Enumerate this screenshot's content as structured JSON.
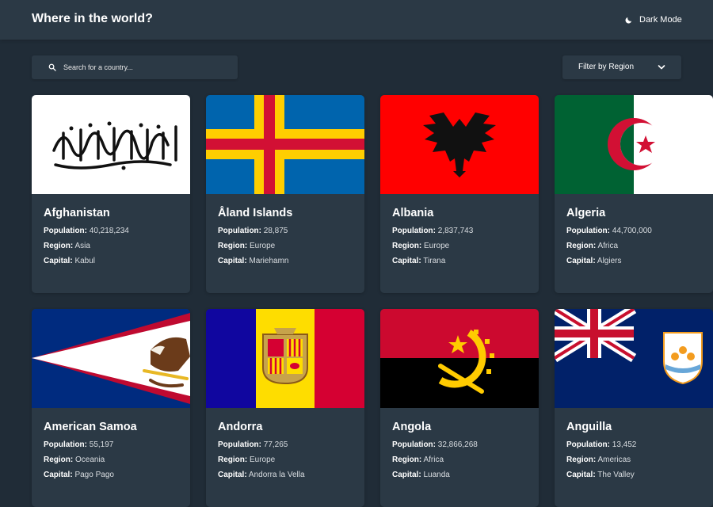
{
  "header": {
    "title": "Where in the world?",
    "dark_mode_label": "Dark Mode",
    "dark_mode_icon": "moon-icon"
  },
  "search": {
    "placeholder": "Search for a country...",
    "value": "",
    "icon": "search-icon"
  },
  "filter": {
    "label": "Filter by Region",
    "icon": "chevron-down-icon"
  },
  "labels": {
    "population": "Population:",
    "region": "Region:",
    "capital": "Capital:"
  },
  "colors": {
    "background": "#202c37",
    "elements": "#2b3945",
    "text": "#ffffff"
  },
  "countries": [
    {
      "name": "Afghanistan",
      "population": "40,218,234",
      "region": "Asia",
      "capital": "Kabul"
    },
    {
      "name": "Åland Islands",
      "population": "28,875",
      "region": "Europe",
      "capital": "Mariehamn"
    },
    {
      "name": "Albania",
      "population": "2,837,743",
      "region": "Europe",
      "capital": "Tirana"
    },
    {
      "name": "Algeria",
      "population": "44,700,000",
      "region": "Africa",
      "capital": "Algiers"
    },
    {
      "name": "American Samoa",
      "population": "55,197",
      "region": "Oceania",
      "capital": "Pago Pago"
    },
    {
      "name": "Andorra",
      "population": "77,265",
      "region": "Europe",
      "capital": "Andorra la Vella"
    },
    {
      "name": "Angola",
      "population": "32,866,268",
      "region": "Africa",
      "capital": "Luanda"
    },
    {
      "name": "Anguilla",
      "population": "13,452",
      "region": "Americas",
      "capital": "The Valley"
    }
  ]
}
